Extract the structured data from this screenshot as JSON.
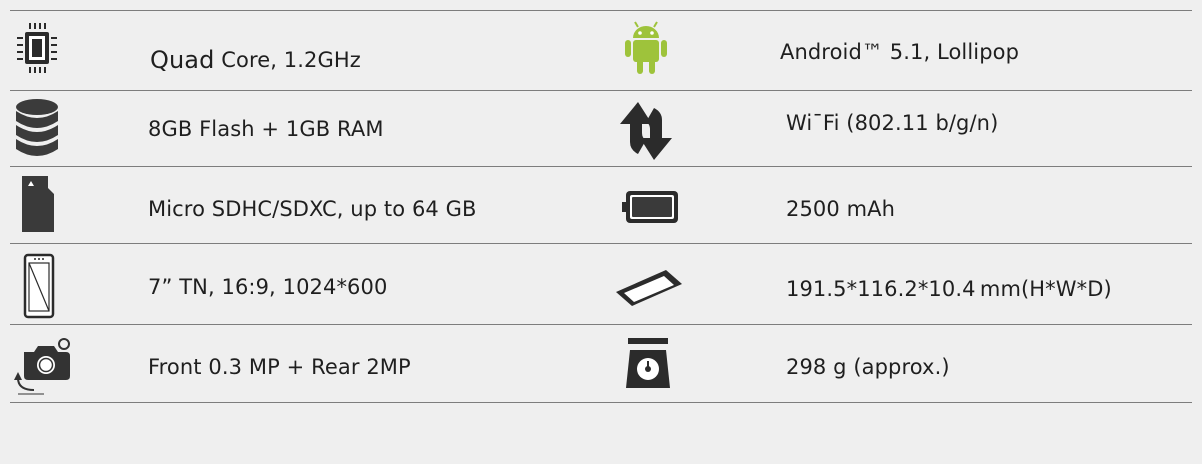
{
  "specs": {
    "cpu": {
      "bold": "Quad",
      "text": "Core, 1.2GHz",
      "icon": "chip-icon"
    },
    "os": {
      "text": "Android™ 5.1, Lollipop",
      "icon": "android-icon"
    },
    "storage": {
      "text": "8GB Flash + 1GB RAM",
      "icon": "storage-icon"
    },
    "wifi": {
      "text": "Wi¯Fi (802.11 b/g/n)",
      "icon": "wifi-arrows-icon"
    },
    "card": {
      "text": "Micro SDHC/SDXC, up to 64 GB",
      "icon": "sd-card-icon"
    },
    "battery": {
      "text": "2500 mAh",
      "icon": "battery-icon"
    },
    "display": {
      "text": "7” TN, 16:9, 1024*600",
      "icon": "phone-screen-icon"
    },
    "dimensions": {
      "text": "191.5*116.2*10.4 mm(H*W*D)",
      "icon": "tablet-dimensions-icon"
    },
    "camera": {
      "text": "Front 0.3 MP + Rear 2MP",
      "icon": "camera-icon"
    },
    "weight": {
      "text": "298 g (approx.)",
      "icon": "scale-icon"
    }
  }
}
